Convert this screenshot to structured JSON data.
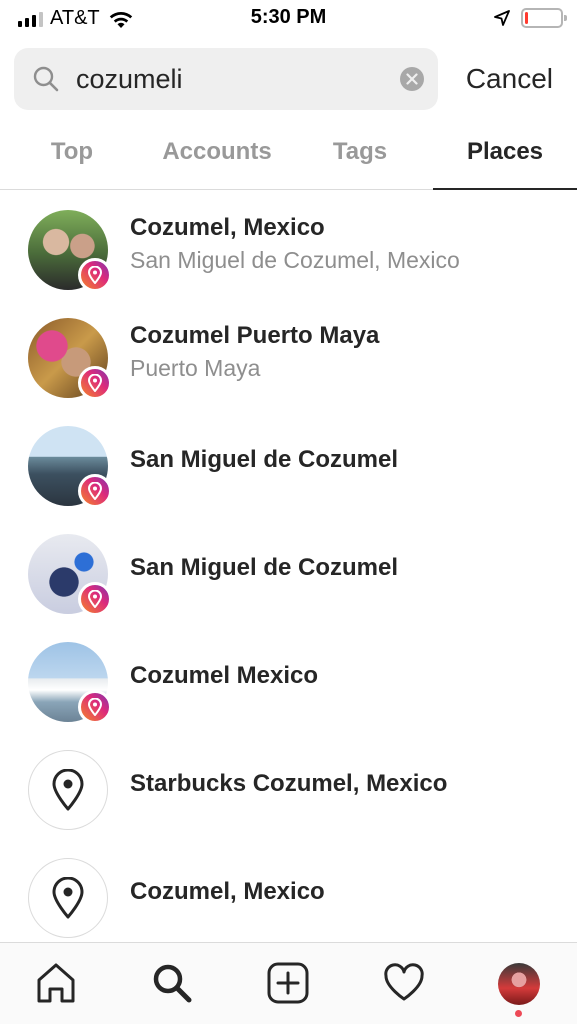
{
  "status_bar": {
    "carrier": "AT&T",
    "time": "5:30 PM",
    "battery_level": 0.1,
    "battery_color": "#ff3b30"
  },
  "search": {
    "query": "cozumeli",
    "cancel_label": "Cancel"
  },
  "tabs": [
    {
      "label": "Top",
      "active": false
    },
    {
      "label": "Accounts",
      "active": false
    },
    {
      "label": "Tags",
      "active": false
    },
    {
      "label": "Places",
      "active": true
    }
  ],
  "results": [
    {
      "title": "Cozumel, Mexico",
      "subtitle": "San Miguel de Cozumel, Mexico",
      "avatar": "photo"
    },
    {
      "title": "Cozumel Puerto Maya",
      "subtitle": "Puerto Maya",
      "avatar": "photo"
    },
    {
      "title": "San Miguel de Cozumel",
      "subtitle": "",
      "avatar": "photo"
    },
    {
      "title": "San Miguel de Cozumel",
      "subtitle": "",
      "avatar": "photo"
    },
    {
      "title": "Cozumel Mexico",
      "subtitle": "",
      "avatar": "photo"
    },
    {
      "title": "Starbucks Cozumel, Mexico",
      "subtitle": "",
      "avatar": "location-pin-icon"
    },
    {
      "title": "Cozumel, Mexico",
      "subtitle": "",
      "avatar": "location-pin-icon"
    }
  ],
  "bottom_nav": {
    "items": [
      "home-icon",
      "search-icon",
      "new-post-icon",
      "activity-heart-icon",
      "profile-avatar"
    ],
    "active": "search-icon",
    "notification_dot_color": "#ed4956"
  },
  "colors": {
    "primary_text": "#262626",
    "secondary_text": "#8e8e8e",
    "inactive_tab": "#999999",
    "badge_gradient": [
      "#f58529",
      "#dd2a7b",
      "#8134af"
    ]
  }
}
